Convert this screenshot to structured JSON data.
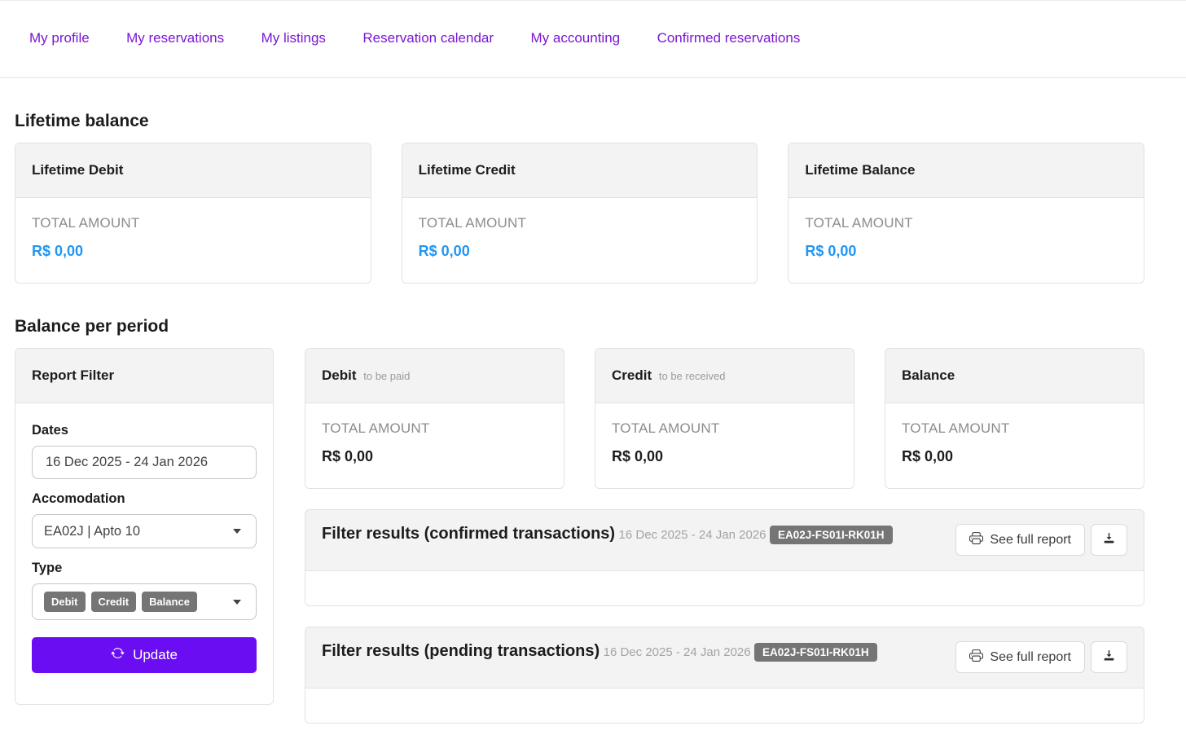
{
  "nav": {
    "items": [
      "My profile",
      "My reservations",
      "My listings",
      "Reservation calendar",
      "My accounting",
      "Confirmed reservations"
    ]
  },
  "lifetime": {
    "heading": "Lifetime balance",
    "cards": [
      {
        "title": "Lifetime Debit",
        "total_label": "TOTAL AMOUNT",
        "amount": "R$ 0,00"
      },
      {
        "title": "Lifetime Credit",
        "total_label": "TOTAL AMOUNT",
        "amount": "R$ 0,00"
      },
      {
        "title": "Lifetime Balance",
        "total_label": "TOTAL AMOUNT",
        "amount": "R$ 0,00"
      }
    ]
  },
  "period": {
    "heading": "Balance per period",
    "filter": {
      "title": "Report Filter",
      "dates_label": "Dates",
      "dates_value": "16 Dec 2025 - 24 Jan 2026",
      "accommodation_label": "Accomodation",
      "accommodation_value": "EA02J | Apto 10",
      "type_label": "Type",
      "type_tags": [
        "Debit",
        "Credit",
        "Balance"
      ],
      "update_label": "Update"
    },
    "cards": [
      {
        "title": "Debit",
        "subtitle": "to be paid",
        "total_label": "TOTAL AMOUNT",
        "amount": "R$ 0,00"
      },
      {
        "title": "Credit",
        "subtitle": "to be received",
        "total_label": "TOTAL AMOUNT",
        "amount": "R$ 0,00"
      },
      {
        "title": "Balance",
        "subtitle": "",
        "total_label": "TOTAL AMOUNT",
        "amount": "R$ 0,00"
      }
    ],
    "sections": [
      {
        "title": "Filter results (confirmed transactions)",
        "date_range": "16 Dec 2025 - 24 Jan 2026",
        "code": "EA02J-FS01I-RK01H",
        "report_label": "See full report"
      },
      {
        "title": "Filter results (pending transactions)",
        "date_range": "16 Dec 2025 - 24 Jan 2026",
        "code": "EA02J-FS01I-RK01H",
        "report_label": "See full report"
      }
    ]
  },
  "colors": {
    "nav_purple": "#7a16d4",
    "accent_purple": "#6b0df2",
    "amount_blue": "#2196f3",
    "badge_gray": "#757575"
  }
}
